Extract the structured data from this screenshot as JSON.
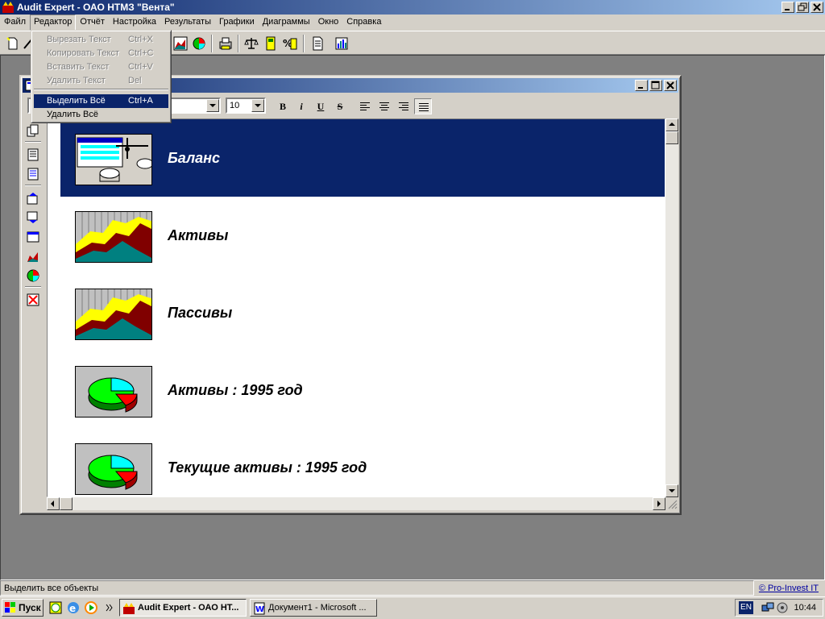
{
  "window": {
    "title": "Audit Expert - ОАО НТМЗ \"Вента\""
  },
  "menubar": [
    "Файл",
    "Редактор",
    "Отчёт",
    "Настройка",
    "Результаты",
    "Графики",
    "Диаграммы",
    "Окно",
    "Справка"
  ],
  "editor_menu": {
    "items": [
      {
        "label": "Вырезать Текст",
        "shortcut": "Ctrl+X",
        "enabled": false
      },
      {
        "label": "Копировать Текст",
        "shortcut": "Ctrl+C",
        "enabled": false
      },
      {
        "label": "Вставить Текст",
        "shortcut": "Ctrl+V",
        "enabled": false
      },
      {
        "label": "Удалить Текст",
        "shortcut": "Del",
        "enabled": false
      },
      {
        "label": "Выделить Всё",
        "shortcut": "Ctrl+A",
        "enabled": true,
        "highlighted": true
      },
      {
        "label": "Удалить Всё",
        "shortcut": "",
        "enabled": true
      }
    ]
  },
  "format_toolbar": {
    "font_name": "",
    "font_size": "10",
    "bold": "B",
    "italic": "i",
    "underline": "U",
    "strike": "S"
  },
  "report_items": [
    {
      "label": "Баланс",
      "icon": "balance-chart-icon",
      "selected": true
    },
    {
      "label": "Активы",
      "icon": "area-chart-icon",
      "selected": false
    },
    {
      "label": "Пассивы",
      "icon": "area-chart-icon",
      "selected": false
    },
    {
      "label": "Активы : 1995 год",
      "icon": "pie-chart-icon",
      "selected": false
    },
    {
      "label": "Текущие активы : 1995 год",
      "icon": "pie-chart-icon",
      "selected": false
    }
  ],
  "statusbar": {
    "text": "Выделить все объекты",
    "link": "© Pro-Invest IT"
  },
  "taskbar": {
    "start": "Пуск",
    "tasks": [
      "Audit Expert - ОАО НТ...",
      "Документ1 - Microsoft ..."
    ],
    "lang": "EN",
    "clock": "10:44"
  },
  "colors": {
    "selection": "#0a246a",
    "face": "#d4d0c8",
    "mdi_bg": "#808080"
  }
}
